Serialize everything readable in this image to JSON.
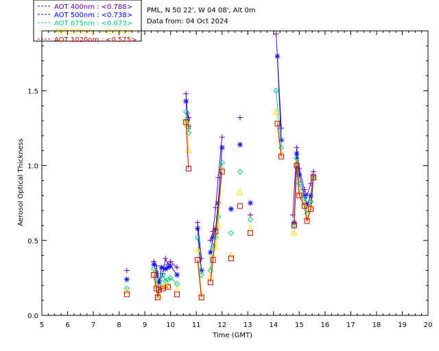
{
  "chart_data": {
    "type": "line",
    "title_lines": [
      "PML, N 50 22', W 04 08', Alt 0m",
      "Data from: 04 Oct 2024"
    ],
    "xlabel": "Time (GMT)",
    "ylabel": "Aerosol Optical Thickness",
    "xlim": [
      5,
      20
    ],
    "ylim": [
      0.0,
      1.9
    ],
    "xticks": [
      5,
      6,
      7,
      8,
      9,
      10,
      11,
      12,
      13,
      14,
      15,
      16,
      17,
      18,
      19,
      20
    ],
    "yticks": [
      0.0,
      0.5,
      1.0,
      1.5
    ],
    "ytick_labels": [
      "0.0",
      "0.5",
      "1.0",
      "1.5"
    ],
    "grid": false,
    "legend_position": "top-left",
    "series": [
      {
        "name": "AOT 400nm : <0.788>",
        "color": "#6600aa",
        "marker": "plus",
        "x": [
          8.3,
          9.35,
          9.45,
          9.55,
          9.7,
          9.8,
          9.9,
          10.0,
          10.25,
          10.6,
          10.65,
          10.7,
          11.05,
          11.2,
          11.55,
          11.65,
          11.75,
          11.85,
          12.0,
          12.35,
          12.7,
          13.1,
          14.1,
          14.3,
          14.75,
          14.9,
          15.0,
          15.2,
          15.3,
          15.45,
          15.55
        ],
        "y": [
          0.3,
          0.36,
          0.33,
          0.22,
          0.28,
          0.38,
          0.34,
          0.36,
          0.32,
          1.48,
          1.35,
          1.32,
          0.62,
          0.38,
          0.5,
          0.56,
          0.72,
          0.92,
          1.19,
          0.71,
          1.32,
          0.67,
          1.88,
          1.25,
          0.67,
          1.12,
          0.98,
          0.84,
          0.8,
          0.88,
          0.96
        ]
      },
      {
        "name": "AOT 500nm : <0.738>",
        "color": "#0000ff",
        "marker": "asterisk",
        "x": [
          8.3,
          9.35,
          9.45,
          9.55,
          9.65,
          9.8,
          9.9,
          10.0,
          10.25,
          10.6,
          10.65,
          10.7,
          11.05,
          11.2,
          11.55,
          11.65,
          11.75,
          11.85,
          12.0,
          12.35,
          12.7,
          13.1,
          14.15,
          14.3,
          14.8,
          14.9,
          15.0,
          15.2,
          15.3,
          15.45,
          15.55
        ],
        "y": [
          0.24,
          0.34,
          0.28,
          0.22,
          0.32,
          0.31,
          0.32,
          0.33,
          0.27,
          1.43,
          1.31,
          1.26,
          0.58,
          0.3,
          0.42,
          0.52,
          0.58,
          0.75,
          1.12,
          0.71,
          1.14,
          0.75,
          1.73,
          1.17,
          0.62,
          1.08,
          0.94,
          0.8,
          0.74,
          0.8,
          0.93
        ]
      },
      {
        "name": "AOT 675nm : <0.673>",
        "color": "#00cc88",
        "marker": "diamond",
        "x": [
          8.3,
          9.35,
          9.45,
          9.55,
          9.7,
          9.8,
          9.9,
          10.0,
          10.25,
          10.6,
          10.65,
          10.7,
          11.05,
          11.2,
          11.55,
          11.65,
          11.75,
          11.85,
          12.0,
          12.35,
          12.7,
          13.1,
          14.1,
          14.3,
          14.8,
          14.9,
          15.0,
          15.2,
          15.3,
          15.45,
          15.55
        ],
        "y": [
          0.18,
          0.31,
          0.24,
          0.16,
          0.27,
          0.23,
          0.24,
          0.25,
          0.21,
          1.36,
          1.3,
          1.22,
          0.52,
          0.27,
          0.3,
          0.46,
          0.52,
          0.66,
          1.02,
          0.55,
          0.96,
          0.64,
          1.5,
          1.12,
          0.6,
          1.05,
          0.88,
          0.78,
          0.68,
          0.76,
          0.92
        ]
      },
      {
        "name": "AOT 870nm : <0.611>",
        "color": "#ffdd00",
        "marker": "triangle",
        "x": [
          8.3,
          9.35,
          9.45,
          9.55,
          9.7,
          9.8,
          9.9,
          10.25,
          10.6,
          10.65,
          10.7,
          11.05,
          11.2,
          11.55,
          11.65,
          11.75,
          11.85,
          12.0,
          12.35,
          12.7,
          13.1,
          14.1,
          14.3,
          14.8,
          14.9,
          15.0,
          15.2,
          15.3,
          15.45,
          15.55
        ],
        "y": [
          0.16,
          0.29,
          0.2,
          0.13,
          0.2,
          0.19,
          0.2,
          0.17,
          1.3,
          1.27,
          1.1,
          0.44,
          0.14,
          0.26,
          0.4,
          0.46,
          0.6,
          0.98,
          0.4,
          0.82,
          0.58,
          1.36,
          1.08,
          0.55,
          1.02,
          0.82,
          0.74,
          0.65,
          0.72,
          0.92
        ]
      },
      {
        "name": "AOT 1020nm : <0.575>",
        "color": "#cc0000",
        "marker": "square",
        "x": [
          8.3,
          9.35,
          9.45,
          9.5,
          9.55,
          9.7,
          9.9,
          10.25,
          10.6,
          10.7,
          11.05,
          11.2,
          11.55,
          11.65,
          11.75,
          12.0,
          12.35,
          12.7,
          13.1,
          14.15,
          14.3,
          14.8,
          14.9,
          15.0,
          15.2,
          15.3,
          15.45,
          15.55
        ],
        "y": [
          0.14,
          0.27,
          0.18,
          0.12,
          0.17,
          0.18,
          0.19,
          0.14,
          1.29,
          0.98,
          0.37,
          0.12,
          0.22,
          0.37,
          0.56,
          0.96,
          0.38,
          0.73,
          0.55,
          1.28,
          1.06,
          0.6,
          1.0,
          0.8,
          0.73,
          0.63,
          0.71,
          0.92
        ]
      }
    ]
  }
}
